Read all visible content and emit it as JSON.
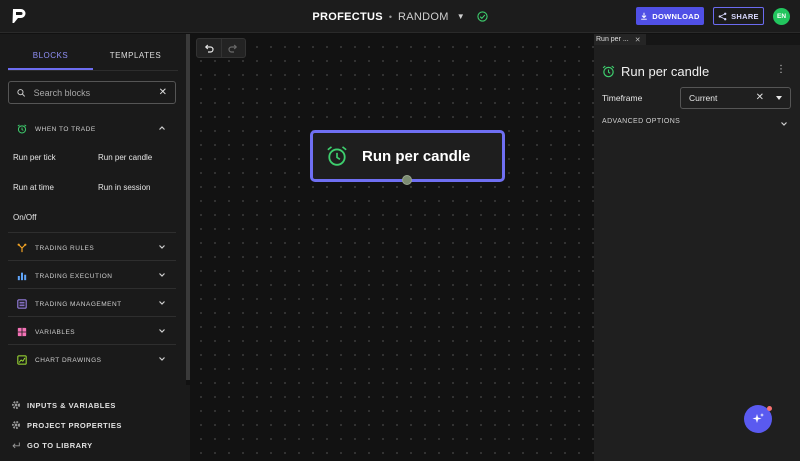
{
  "topbar": {
    "project_name": "PROFECTUS",
    "separator": "•",
    "file_name": "RANDOM",
    "download_label": "DOWNLOAD",
    "share_label": "SHARE",
    "avatar_initials": "EN"
  },
  "sidebar": {
    "tabs": [
      "BLOCKS",
      "TEMPLATES"
    ],
    "active_tab": "BLOCKS",
    "search": {
      "placeholder": "Search blocks",
      "value": ""
    },
    "sections": [
      {
        "label": "WHEN TO TRADE",
        "icon": "alarm-clock-icon",
        "expanded": true,
        "items": [
          "Run per tick",
          "Run per candle",
          "Run at time",
          "Run in session",
          "On/Off"
        ]
      },
      {
        "label": "TRADING RULES",
        "icon": "branch-icon",
        "expanded": false
      },
      {
        "label": "TRADING EXECUTION",
        "icon": "bar-chart-icon",
        "expanded": false
      },
      {
        "label": "TRADING MANAGEMENT",
        "icon": "list-icon",
        "expanded": false
      },
      {
        "label": "VARIABLES",
        "icon": "grid-icon",
        "expanded": false
      },
      {
        "label": "CHART DRAWINGS",
        "icon": "chart-draw-icon",
        "expanded": false
      }
    ],
    "bottom_links": [
      "INPUTS & VARIABLES",
      "PROJECT PROPERTIES",
      "GO TO LIBRARY"
    ]
  },
  "canvas": {
    "node": {
      "label": "Run per candle",
      "icon": "alarm-clock-icon"
    }
  },
  "panel": {
    "tab_label": "Run per ...",
    "title": "Run per candle",
    "timeframe_label": "Timeframe",
    "timeframe_value": "Current",
    "advanced_label": "ADVANCED OPTIONS"
  },
  "colors": {
    "accent": "#5a5af0",
    "node_border": "#6f6ff2",
    "success": "#22c55e",
    "icon_green": "#3ecf6e"
  }
}
